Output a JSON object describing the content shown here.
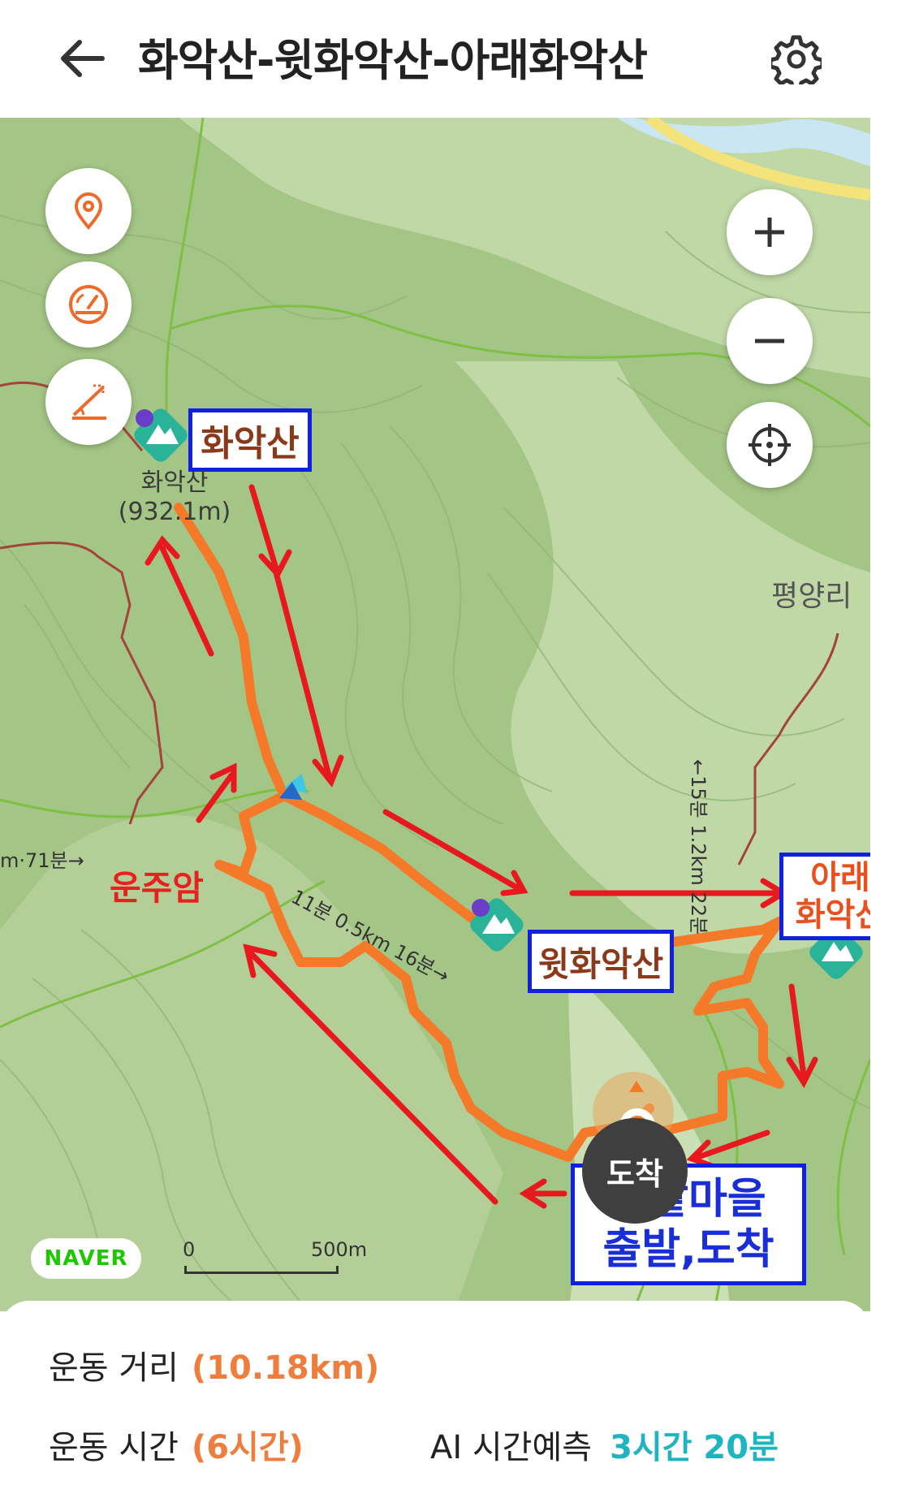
{
  "header": {
    "title": "화악산-윗화악산-아래화악산",
    "back_icon": "back-arrow-icon",
    "settings_icon": "gear-icon"
  },
  "map": {
    "controls": {
      "left": [
        "location-pin-icon",
        "speedometer-icon",
        "elevation-profile-icon"
      ],
      "right": [
        "zoom-in-icon",
        "zoom-out-icon",
        "locate-target-icon"
      ]
    },
    "labels": {
      "peak_main_box": "화악산",
      "peak_main_name": "화악산",
      "peak_main_elev": "(932.1m)",
      "peak_upper_box": "윗화악산",
      "peak_lower_box": "아래\n화악산",
      "hermitage": "운주암",
      "village": "평양리",
      "start_end_box": "평밭마을\n출발,도착",
      "arrive_pin": "도착",
      "route_time_left": "m·71분→",
      "route_time_mid": "11분 0.5km 16분→",
      "route_time_right": "←15분 1.2km 22분"
    },
    "brand": "NAVER",
    "scale": {
      "zero": "0",
      "max": "500m"
    },
    "colors": {
      "route": "#f47a2a",
      "arrow": "#e8191e",
      "box_border": "#1020e0"
    }
  },
  "stats": {
    "distance_label": "운동 거리",
    "distance_value": "(10.18km)",
    "time_label": "운동 시간",
    "time_value": "(6시간)",
    "ai_label": "AI 시간예측",
    "ai_value": "3시간 20분"
  }
}
